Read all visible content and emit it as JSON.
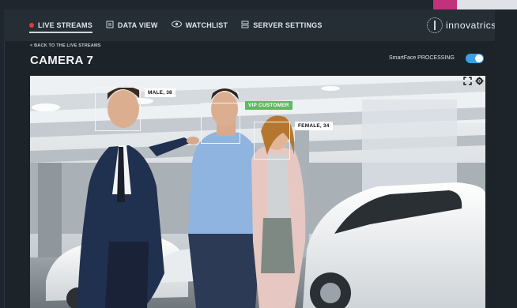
{
  "nav": {
    "items": [
      {
        "label": "LIVE STREAMS",
        "icon": "live-dot-icon",
        "active": true
      },
      {
        "label": "DATA VIEW",
        "icon": "data-view-icon",
        "active": false
      },
      {
        "label": "WATCHLIST",
        "icon": "watchlist-eye-icon",
        "active": false
      },
      {
        "label": "SERVER SETTINGS",
        "icon": "server-settings-icon",
        "active": false
      }
    ],
    "logo_text": "innovatrics"
  },
  "page": {
    "back_link": "< BACK TO THE LIVE STREAMS",
    "title": "CAMERA 7",
    "processing_label": "SmartFace PROCESSING",
    "processing_on": true
  },
  "video": {
    "detections": [
      {
        "label": "MALE, 38",
        "vip": false
      },
      {
        "label": "VIP CUSTOMER",
        "vip": true
      },
      {
        "label": "FEMALE, 34",
        "vip": false
      }
    ]
  },
  "colors": {
    "accent_toggle": "#3aa0e6",
    "live_dot": "#e03a3a",
    "vip_tag": "#5dbb63",
    "navbar_bg": "#252d35"
  }
}
